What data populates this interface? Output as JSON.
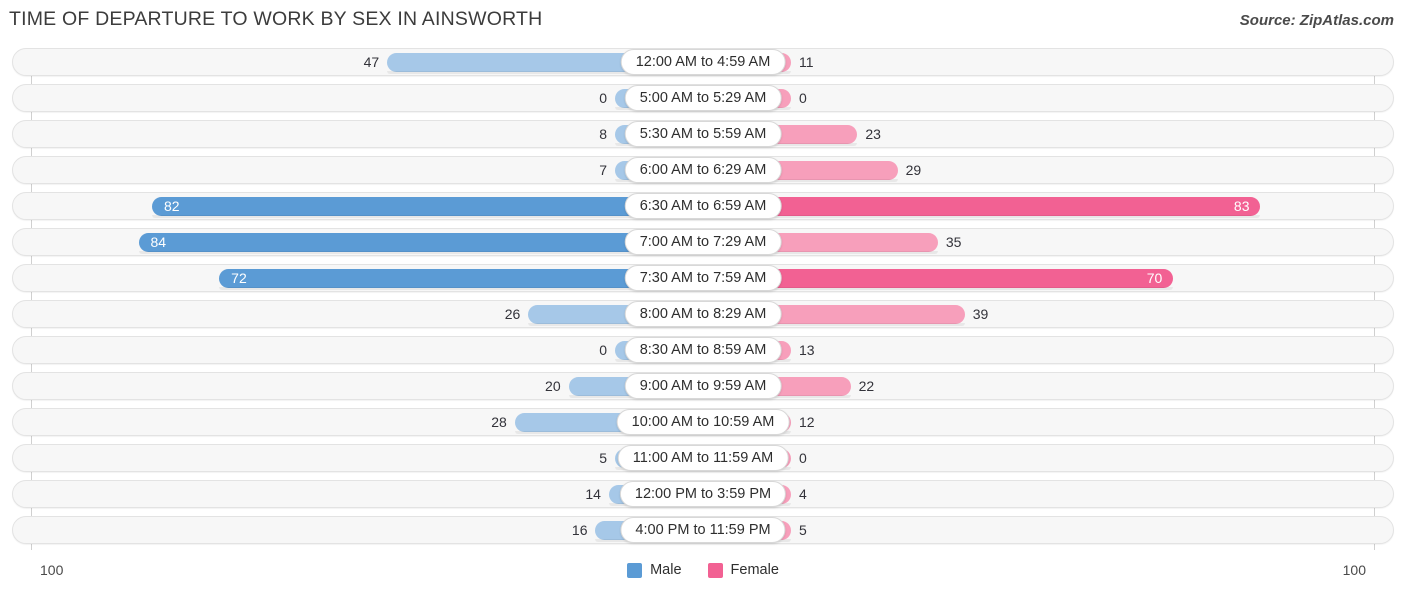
{
  "header": {
    "title": "TIME OF DEPARTURE TO WORK BY SEX IN AINSWORTH",
    "source": "Source: ZipAtlas.com"
  },
  "footer": {
    "axis_max_left": "100",
    "axis_max_right": "100",
    "legend": [
      {
        "label": "Male",
        "color": "#5b9bd5"
      },
      {
        "label": "Female",
        "color": "#f26193"
      }
    ]
  },
  "chart_data": {
    "type": "bar",
    "subtype": "diverging-bidirectional",
    "title": "TIME OF DEPARTURE TO WORK BY SEX IN AINSWORTH",
    "xlabel": "",
    "ylabel": "",
    "xlim": [
      100,
      100
    ],
    "axis_max": 100,
    "grid": false,
    "legend_position": "bottom-center",
    "categories": [
      "12:00 AM to 4:59 AM",
      "5:00 AM to 5:29 AM",
      "5:30 AM to 5:59 AM",
      "6:00 AM to 6:29 AM",
      "6:30 AM to 6:59 AM",
      "7:00 AM to 7:29 AM",
      "7:30 AM to 7:59 AM",
      "8:00 AM to 8:29 AM",
      "8:30 AM to 8:59 AM",
      "9:00 AM to 9:59 AM",
      "10:00 AM to 10:59 AM",
      "11:00 AM to 11:59 AM",
      "12:00 PM to 3:59 PM",
      "4:00 PM to 11:59 PM"
    ],
    "series": [
      {
        "name": "Male",
        "color": "#5b9bd5",
        "direction": "left",
        "values": [
          47,
          0,
          8,
          7,
          82,
          84,
          72,
          26,
          0,
          20,
          28,
          5,
          14,
          16
        ]
      },
      {
        "name": "Female",
        "color": "#f26193",
        "direction": "right",
        "values": [
          11,
          0,
          23,
          29,
          83,
          35,
          70,
          39,
          13,
          22,
          12,
          0,
          4,
          5
        ]
      }
    ]
  },
  "rows": [
    {
      "label": "12:00 AM to 4:59 AM",
      "male": "47",
      "female": "11"
    },
    {
      "label": "5:00 AM to 5:29 AM",
      "male": "0",
      "female": "0"
    },
    {
      "label": "5:30 AM to 5:59 AM",
      "male": "8",
      "female": "23"
    },
    {
      "label": "6:00 AM to 6:29 AM",
      "male": "7",
      "female": "29"
    },
    {
      "label": "6:30 AM to 6:59 AM",
      "male": "82",
      "female": "83"
    },
    {
      "label": "7:00 AM to 7:29 AM",
      "male": "84",
      "female": "35"
    },
    {
      "label": "7:30 AM to 7:59 AM",
      "male": "72",
      "female": "70"
    },
    {
      "label": "8:00 AM to 8:29 AM",
      "male": "26",
      "female": "39"
    },
    {
      "label": "8:30 AM to 8:59 AM",
      "male": "0",
      "female": "13"
    },
    {
      "label": "9:00 AM to 9:59 AM",
      "male": "20",
      "female": "22"
    },
    {
      "label": "10:00 AM to 10:59 AM",
      "male": "28",
      "female": "12"
    },
    {
      "label": "11:00 AM to 11:59 AM",
      "male": "5",
      "female": "0"
    },
    {
      "label": "12:00 PM to 3:59 PM",
      "male": "14",
      "female": "4"
    },
    {
      "label": "4:00 PM to 11:59 PM",
      "male": "16",
      "female": "5"
    }
  ]
}
